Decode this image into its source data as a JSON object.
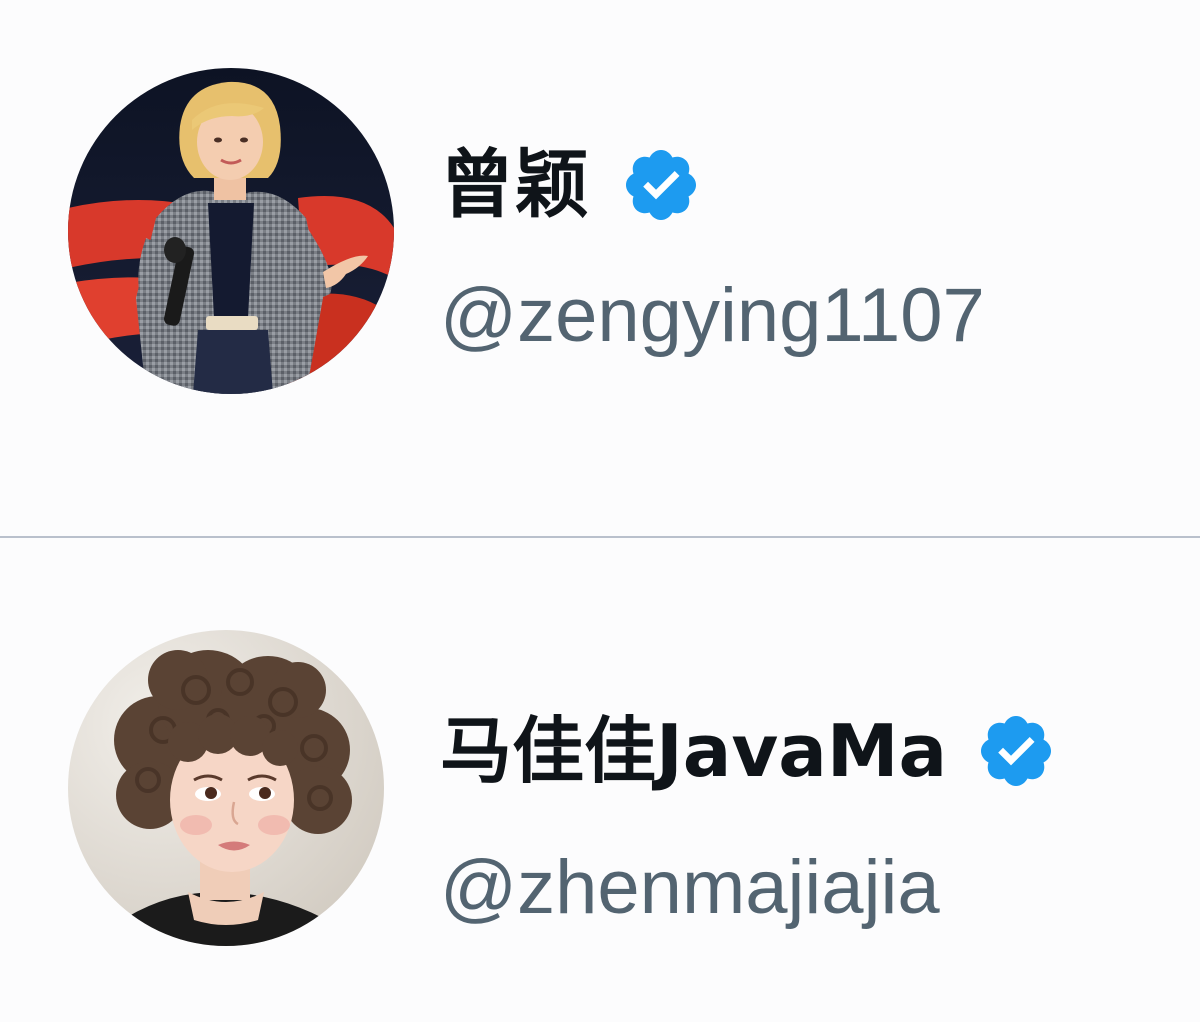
{
  "profiles": [
    {
      "display_name": "曾颖",
      "handle": "@zengying1107",
      "verified": true,
      "avatar_icon": "avatar-woman-speaking-on-stage"
    },
    {
      "display_name": "马佳佳JavaMa",
      "handle": "@zhenmajiajia",
      "verified": true,
      "avatar_icon": "avatar-woman-curly-hair"
    }
  ],
  "colors": {
    "background": "#fcfcfd",
    "name_text": "#0f1419",
    "handle_text": "#536471",
    "verified_badge": "#1d9bf0",
    "divider": "#b9c0cc"
  }
}
